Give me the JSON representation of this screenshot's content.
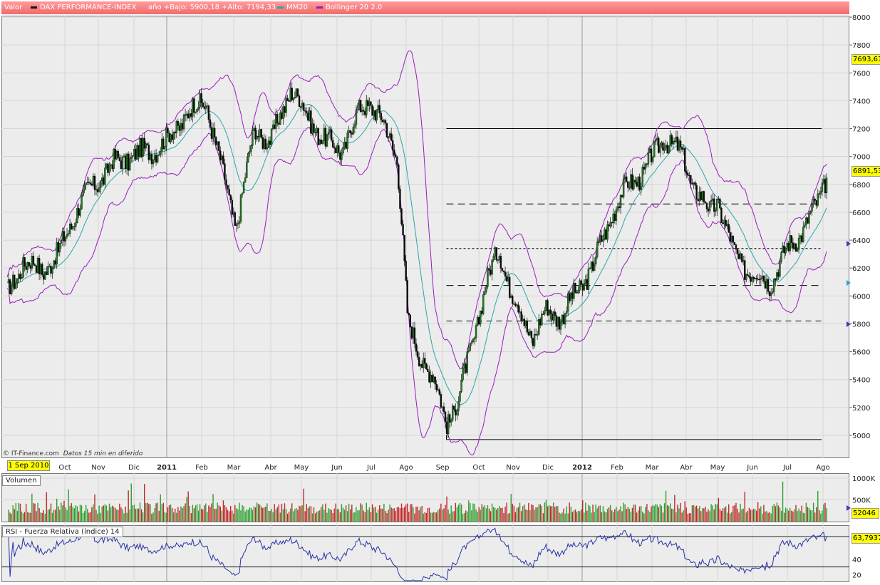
{
  "legend": {
    "valor": "Valor",
    "instrument": "DAX PERFORMANCE-INDEX",
    "range": "año +Bajo: 5900,18 +Alto: 7194,33",
    "ma": "MM20",
    "bollinger": "Bollinger 20 2.0"
  },
  "footer": {
    "source": "© IT-Finance.com",
    "delay": "Datos 15 min en diferido"
  },
  "date_tag": "1 Sep 2010",
  "volume_panel": {
    "label": "Volumen",
    "last_value_label": "52046"
  },
  "rsi_panel": {
    "label": "RSI - Fuerza Relativa (índice) 14",
    "last_value_label": "63,7937"
  },
  "price_panel": {
    "current_price_label": "6891,53",
    "bollinger_high_label": "7693,61"
  },
  "colors": {
    "up_candle": "#1f7f1f",
    "down_candle": "#0a0a0a",
    "ma": "#2aa6a6",
    "bollinger": "#9b1bbf",
    "rsi": "#2633a8",
    "vol_up": "#2e9e2e",
    "vol_down": "#c02828",
    "legend_bg": "#f07070",
    "axis_tag": "#ffff00"
  },
  "chart_data": [
    {
      "type": "line",
      "title": "DAX PERFORMANCE-INDEX",
      "xlabel": "",
      "ylabel": "",
      "x_ticks": [
        "Oct",
        "Nov",
        "Dic",
        "2011",
        "Feb",
        "Mar",
        "Abr",
        "May",
        "Jun",
        "Jul",
        "Ago",
        "Sep",
        "Oct",
        "Nov",
        "Dic",
        "2012",
        "Feb",
        "Mar",
        "Abr",
        "May",
        "Jun",
        "Jul",
        "Ago"
      ],
      "y_ticks": [
        5000,
        5200,
        5400,
        5600,
        5800,
        6000,
        6200,
        6400,
        6600,
        6800,
        7000,
        7200,
        7400,
        7600,
        7800,
        8000
      ],
      "ylim": [
        4930,
        8020
      ],
      "grid": true,
      "series": [
        {
          "name": "DAX PERFORMANCE-INDEX",
          "x": [
            "2010-09-01",
            "2010-09-15",
            "2010-10-01",
            "2010-10-15",
            "2010-11-01",
            "2010-11-15",
            "2010-12-01",
            "2010-12-15",
            "2011-01-03",
            "2011-01-15",
            "2011-02-01",
            "2011-02-18",
            "2011-03-01",
            "2011-03-16",
            "2011-04-01",
            "2011-04-15",
            "2011-05-02",
            "2011-05-15",
            "2011-06-01",
            "2011-06-15",
            "2011-07-01",
            "2011-07-08",
            "2011-07-22",
            "2011-08-01",
            "2011-08-05",
            "2011-08-10",
            "2011-08-19",
            "2011-09-01",
            "2011-09-12",
            "2011-09-22",
            "2011-10-01",
            "2011-10-15",
            "2011-10-27",
            "2011-11-07",
            "2011-11-25",
            "2011-12-07",
            "2011-12-20",
            "2012-01-03",
            "2012-01-15",
            "2012-02-01",
            "2012-02-15",
            "2012-03-01",
            "2012-03-16",
            "2012-04-01",
            "2012-04-10",
            "2012-04-24",
            "2012-05-01",
            "2012-05-15",
            "2012-06-01",
            "2012-06-15",
            "2012-07-01",
            "2012-07-15",
            "2012-07-25",
            "2012-08-03"
          ],
          "y": [
            6000,
            6250,
            6180,
            6300,
            6650,
            6800,
            6950,
            7000,
            7050,
            7100,
            7300,
            7400,
            7000,
            6500,
            7200,
            7100,
            7500,
            7300,
            7100,
            7050,
            7350,
            7400,
            7200,
            7000,
            6500,
            5800,
            5600,
            5400,
            5100,
            5250,
            5550,
            6050,
            6350,
            6000,
            5700,
            5900,
            5850,
            6050,
            6200,
            6600,
            6800,
            6900,
            7150,
            7000,
            6800,
            6600,
            6700,
            6300,
            6150,
            6100,
            6350,
            6500,
            6650,
            6890
          ]
        },
        {
          "name": "MM20",
          "y": []
        },
        {
          "name": "Bollinger 20 2.0",
          "y": []
        }
      ]
    },
    {
      "type": "bar",
      "title": "Volumen",
      "y_ticks": [
        "500K",
        "1000K"
      ],
      "ylim": [
        0,
        1050000
      ],
      "last_value": 52046
    },
    {
      "type": "line",
      "title": "RSI - Fuerza Relativa (índice) 14",
      "y_ticks": [
        20,
        40
      ],
      "ylim": [
        10,
        85
      ],
      "reference_lines": [
        30,
        70
      ],
      "last_value": 63.7937
    }
  ]
}
